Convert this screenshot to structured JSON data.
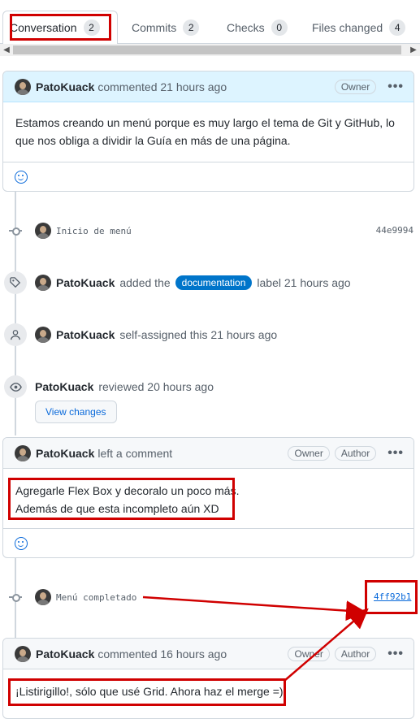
{
  "tabs": [
    {
      "label": "Conversation",
      "count": "2"
    },
    {
      "label": "Commits",
      "count": "2"
    },
    {
      "label": "Checks",
      "count": "0"
    },
    {
      "label": "Files changed",
      "count": "4"
    }
  ],
  "comment1": {
    "author": "PatoKuack",
    "meta": "commented 21 hours ago",
    "badge": "Owner",
    "body": "Estamos creando un menú porque es muy largo el tema de Git y GitHub, lo que nos obliga a dividir la Guía en más de una página."
  },
  "commit1": {
    "message": "Inicio de menú",
    "sha": "44e9994"
  },
  "event_label": {
    "author": "PatoKuack",
    "pre": "added the",
    "label": "documentation",
    "post": "label 21 hours ago"
  },
  "event_assign": {
    "author": "PatoKuack",
    "text": "self-assigned this 21 hours ago"
  },
  "event_review": {
    "author": "PatoKuack",
    "text": "reviewed 20 hours ago",
    "button": "View changes"
  },
  "comment2": {
    "author": "PatoKuack",
    "meta": "left a comment",
    "badge1": "Owner",
    "badge2": "Author",
    "line1": "Agregarle Flex Box y decoralo un poco más.",
    "line2": "Además de que esta incompleto aún XD"
  },
  "commit2": {
    "message": "Menú completado",
    "sha": "4ff92b1"
  },
  "comment3": {
    "author": "PatoKuack",
    "meta": "commented 16 hours ago",
    "badge1": "Owner",
    "badge2": "Author",
    "body": "¡Listirigillo!, sólo que usé Grid. Ahora haz el merge =)"
  },
  "kebab": "•••",
  "scroll": {
    "left": "◀",
    "right": "▶"
  },
  "colors": {
    "annotation_red": "#d00000",
    "label_blue": "#0075ca",
    "link_blue": "#0969da"
  }
}
